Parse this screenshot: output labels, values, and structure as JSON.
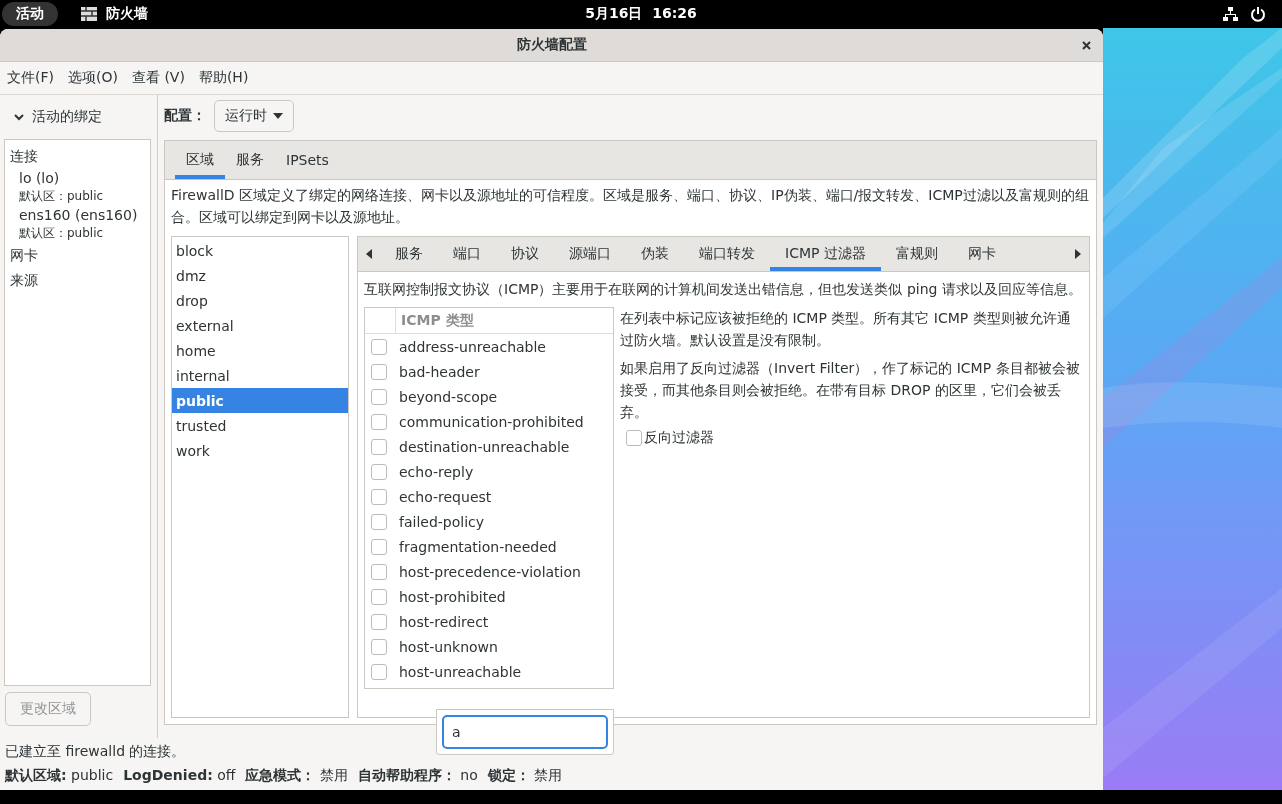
{
  "top_bar": {
    "activities": "活动",
    "app_name": "防火墙",
    "clock": "5月16日  16:26"
  },
  "window": {
    "title": "防火墙配置"
  },
  "menu": [
    "文件(F)",
    "选项(O)",
    "查看 (V)",
    "帮助(H)"
  ],
  "bindings": {
    "header": "活动的绑定",
    "expanded": true,
    "items": [
      {
        "label": "连接",
        "children": [
          {
            "name": "lo (lo)",
            "zone": "默认区：public"
          },
          {
            "name": "ens160 (ens160)",
            "zone": "默认区：public"
          }
        ]
      },
      {
        "label": "网卡"
      },
      {
        "label": "来源"
      }
    ],
    "change_zone_button": {
      "label": "更改区域",
      "disabled": true
    }
  },
  "configuration": {
    "label": "配置：",
    "value": "运行时"
  },
  "tabs": [
    {
      "label": "区域",
      "selected": true
    },
    {
      "label": "服务",
      "selected": false
    },
    {
      "label": "IPSets",
      "selected": false
    }
  ],
  "zones_description": "FirewallD 区域定义了绑定的网络连接、网卡以及源地址的可信程度。区域是服务、端口、协议、IP伪装、端口/报文转发、ICMP过滤以及富规则的组合。区域可以绑定到网卡以及源地址。",
  "zones": [
    {
      "name": "block",
      "selected": false
    },
    {
      "name": "dmz",
      "selected": false
    },
    {
      "name": "drop",
      "selected": false
    },
    {
      "name": "external",
      "selected": false
    },
    {
      "name": "home",
      "selected": false
    },
    {
      "name": "internal",
      "selected": false
    },
    {
      "name": "public",
      "selected": true
    },
    {
      "name": "trusted",
      "selected": false
    },
    {
      "name": "work",
      "selected": false
    }
  ],
  "zone_tabs": [
    {
      "label": "服务",
      "selected": false
    },
    {
      "label": "端口",
      "selected": false
    },
    {
      "label": "协议",
      "selected": false
    },
    {
      "label": "源端口",
      "selected": false
    },
    {
      "label": "伪装",
      "selected": false
    },
    {
      "label": "端口转发",
      "selected": false
    },
    {
      "label": "ICMP 过滤器",
      "selected": true
    },
    {
      "label": "富规则",
      "selected": false
    },
    {
      "label": "网卡",
      "selected": false
    }
  ],
  "icmp_description": "互联网控制报文协议（ICMP）主要用于在联网的计算机间发送出错信息，但也发送类似 ping 请求以及回应等信息。",
  "icmp_table": {
    "column": "ICMP 类型",
    "rows": [
      {
        "name": "address-unreachable",
        "checked": false
      },
      {
        "name": "bad-header",
        "checked": false
      },
      {
        "name": "beyond-scope",
        "checked": false
      },
      {
        "name": "communication-prohibited",
        "checked": false
      },
      {
        "name": "destination-unreachable",
        "checked": false
      },
      {
        "name": "echo-reply",
        "checked": false
      },
      {
        "name": "echo-request",
        "checked": false
      },
      {
        "name": "failed-policy",
        "checked": false
      },
      {
        "name": "fragmentation-needed",
        "checked": false
      },
      {
        "name": "host-precedence-violation",
        "checked": false
      },
      {
        "name": "host-prohibited",
        "checked": false
      },
      {
        "name": "host-redirect",
        "checked": false
      },
      {
        "name": "host-unknown",
        "checked": false
      },
      {
        "name": "host-unreachable",
        "checked": false
      }
    ]
  },
  "icmp_help": [
    "在列表中标记应该被拒绝的 ICMP 类型。所有其它 ICMP 类型则被允许通过防火墙。默认设置是没有限制。",
    "如果启用了反向过滤器（Invert Filter），作了标记的 ICMP 条目都被会被接受，而其他条目则会被拒绝。在带有目标 DROP 的区里，它们会被丢弃。"
  ],
  "invert_filter": {
    "label": "反向过滤器",
    "checked": false
  },
  "search_popup": {
    "value": "a"
  },
  "status_message": "已建立至 firewalld 的连接。",
  "status_items": [
    {
      "label": "默认区域:",
      "value": "public"
    },
    {
      "label": "LogDenied:",
      "value": "off"
    },
    {
      "label": "应急模式：",
      "value": "禁用"
    },
    {
      "label": "自动帮助程序：",
      "value": "no"
    },
    {
      "label": "锁定：",
      "value": "禁用"
    }
  ]
}
